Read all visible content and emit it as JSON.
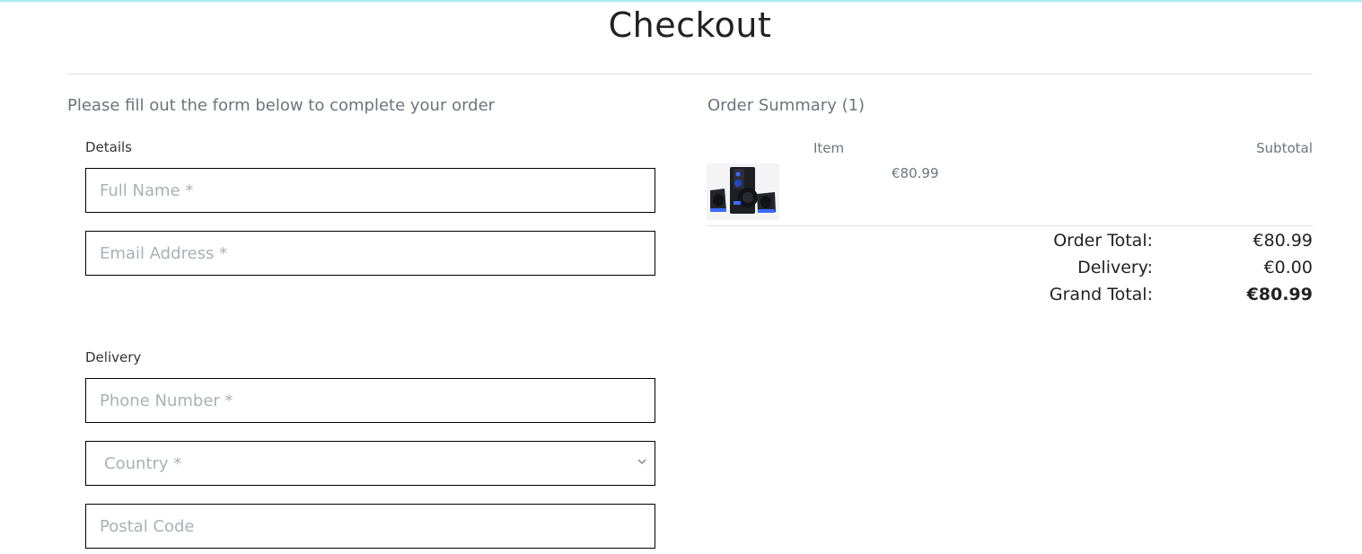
{
  "page": {
    "title": "Checkout",
    "intro": "Please fill out the form below to complete your order"
  },
  "form": {
    "details_label": "Details",
    "full_name_placeholder": "Full Name *",
    "email_placeholder": "Email Address *",
    "delivery_label": "Delivery",
    "phone_placeholder": "Phone Number *",
    "country_selected": "Country *",
    "postal_placeholder": "Postal Code"
  },
  "summary": {
    "title": "Order Summary (1)",
    "item_header": "Item",
    "subtotal_header": "Subtotal",
    "items": [
      {
        "image": "speaker-set-image",
        "price": "€80.99"
      }
    ],
    "order_total_label": "Order Total:",
    "order_total_value": "€80.99",
    "delivery_label": "Delivery:",
    "delivery_value": "€0.00",
    "grand_total_label": "Grand Total:",
    "grand_total_value": "€80.99"
  },
  "colors": {
    "accent": "#8fe8f5",
    "muted_text": "#6c757d",
    "placeholder": "#aab0b7",
    "field_border": "#000000"
  }
}
